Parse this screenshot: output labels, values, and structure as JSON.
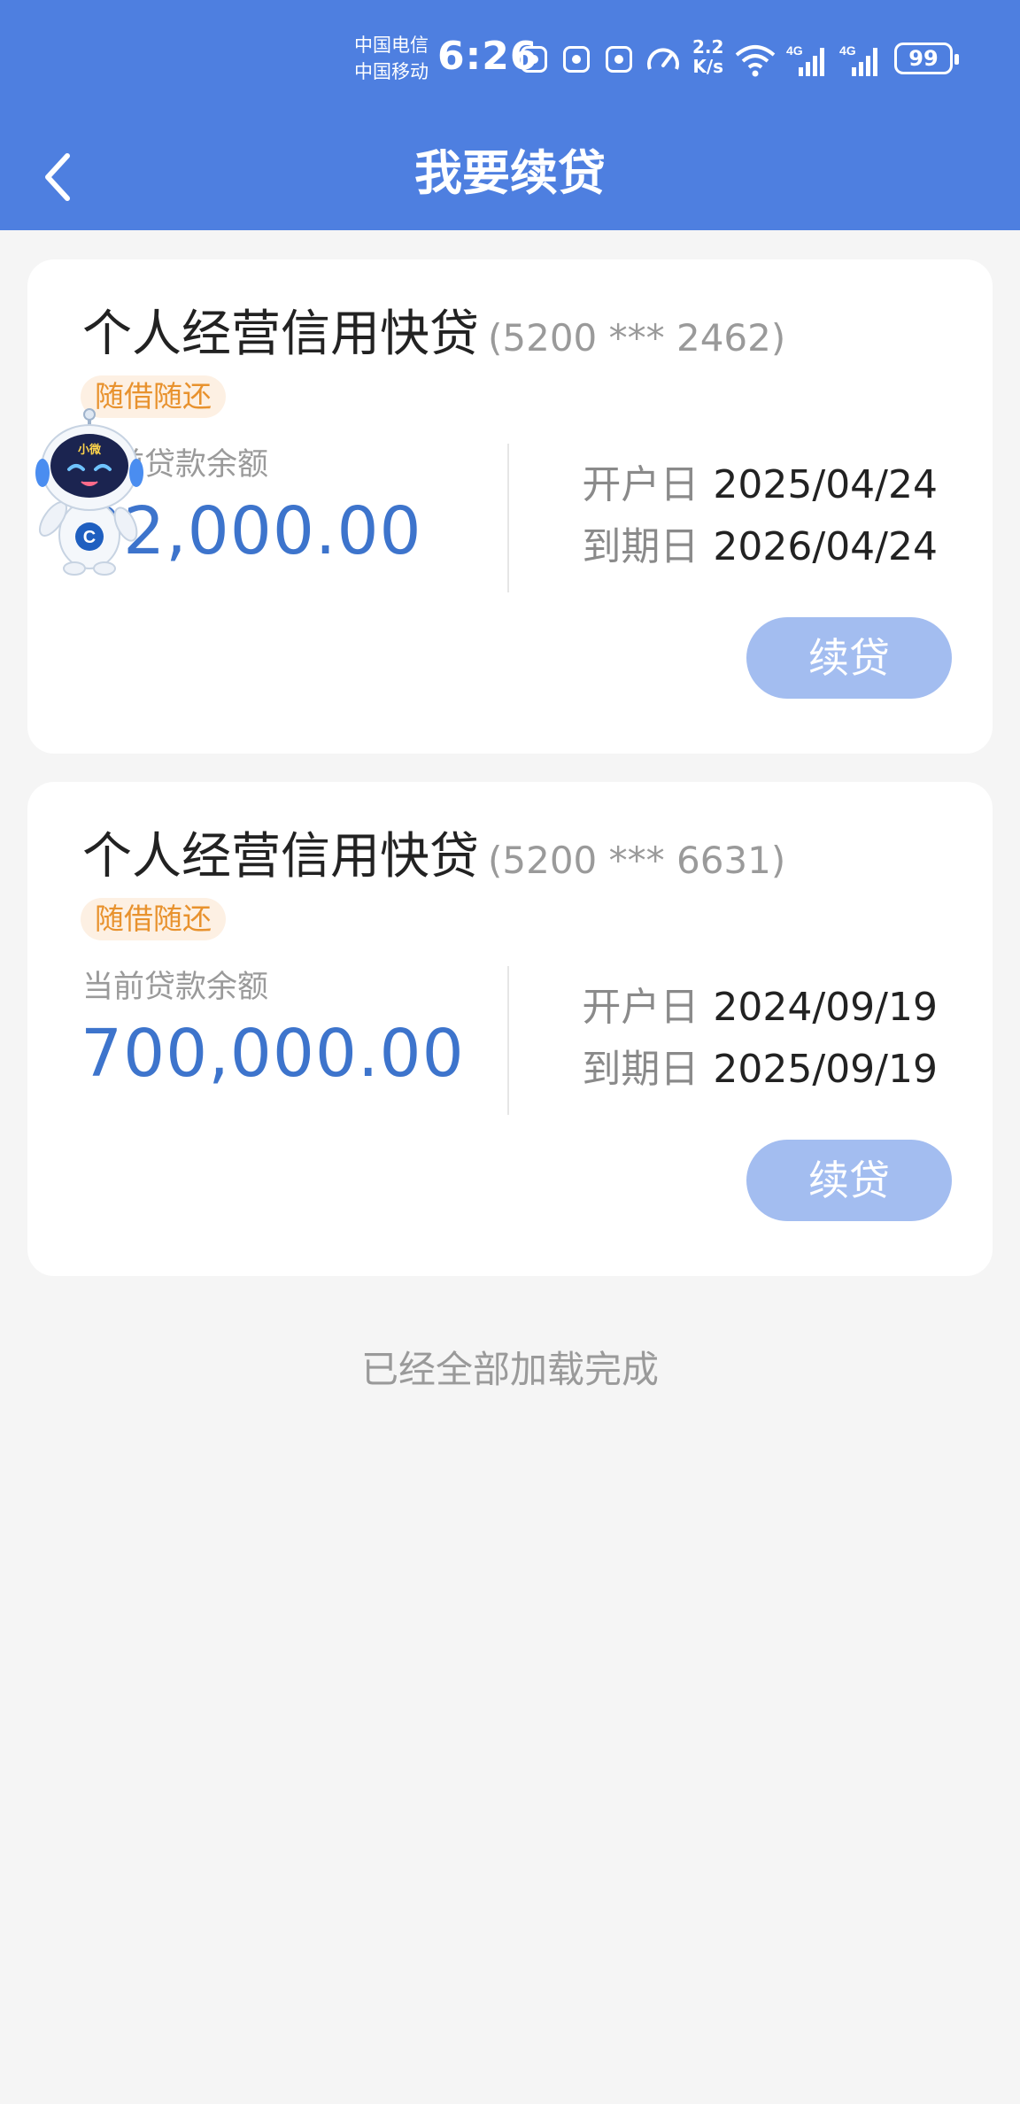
{
  "status_bar": {
    "carrier_1": "中国电信",
    "carrier_2": "中国移动",
    "time": "6:26",
    "net_speed_value": "2.2",
    "net_speed_unit": "K/s",
    "battery": "99"
  },
  "header": {
    "title": "我要续贷"
  },
  "loans": [
    {
      "name": "个人经营信用快贷",
      "account": "(5200 *** 2462)",
      "tag": "随借随还",
      "balance_label": "当前贷款余额",
      "balance": "32,000.00",
      "open_label": "开户日",
      "open_date": "2025/04/24",
      "due_label": "到期日",
      "due_date": "2026/04/24",
      "button": "续贷"
    },
    {
      "name": "个人经营信用快贷",
      "account": "(5200 *** 6631)",
      "tag": "随借随还",
      "balance_label": "当前贷款余额",
      "balance": "700,000.00",
      "open_label": "开户日",
      "open_date": "2024/09/19",
      "due_label": "到期日",
      "due_date": "2025/09/19",
      "button": "续贷"
    }
  ],
  "footer": "已经全部加载完成",
  "mascot": {
    "badge_text": "小微",
    "icon": "robot-mascot-icon"
  },
  "colors": {
    "header": "#4e7fe0",
    "amount": "#3d74cc",
    "button": "#a3bdf0",
    "tag_text": "#e8922e",
    "tag_bg": "#fdf0e3"
  }
}
